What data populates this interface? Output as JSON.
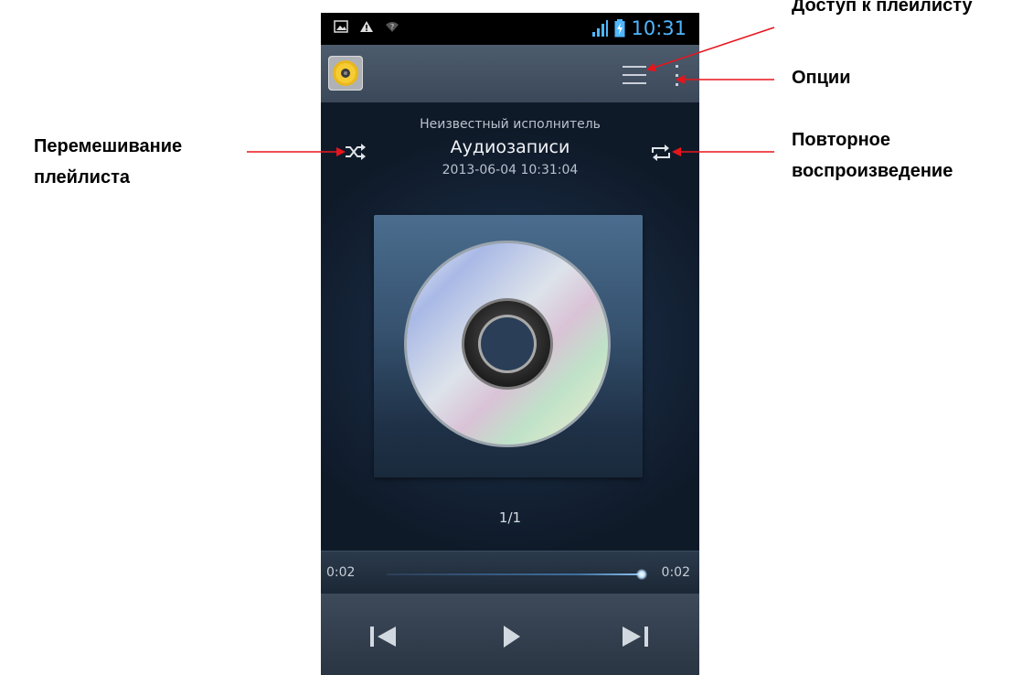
{
  "annotations": {
    "playlist_access": "Доступ к плейлисту",
    "options": "Опции",
    "shuffle_line1": "Перемешивание",
    "shuffle_line2": "плейлиста",
    "repeat_line1": "Повторное",
    "repeat_line2": "воспроизведение",
    "arrow_color": "#e8141b"
  },
  "statusbar": {
    "clock": "10:31",
    "icons": [
      "gallery-icon",
      "warning-icon",
      "wifi-icon",
      "signal-icon",
      "battery-charging-icon"
    ]
  },
  "actionbar": {
    "app_icon": "speaker-icon",
    "playlist_button_icon": "list-icon",
    "overflow_button_icon": "overflow-menu-icon"
  },
  "track": {
    "artist": "Неизвестный исполнитель",
    "album": "Аудиозаписи",
    "datetime": "2013-06-04 10:31:04"
  },
  "album_art_icon": "cd-disc-icon",
  "page_count": "1/1",
  "progress": {
    "current": "0:02",
    "total": "0:02",
    "fraction": 1.0
  },
  "controls": {
    "icons": [
      "previous-icon",
      "play-icon",
      "next-icon"
    ]
  },
  "colors": {
    "accent_blue": "#4fb6ff",
    "background": "#16263b"
  }
}
